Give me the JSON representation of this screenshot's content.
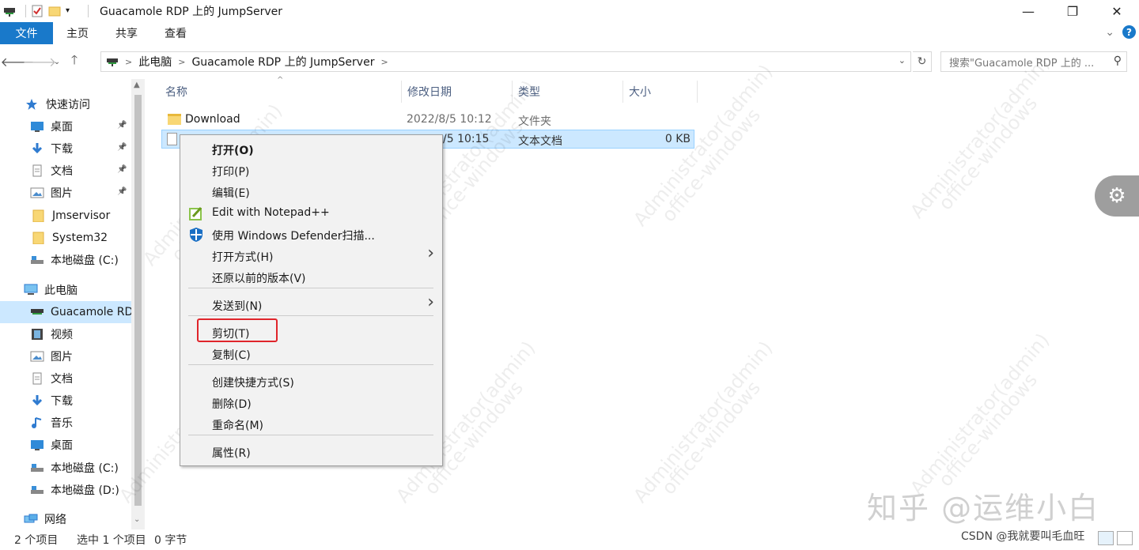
{
  "window": {
    "title": "Guacamole RDP 上的 JumpServer",
    "minimize": "—",
    "restore": "❐",
    "close": "✕"
  },
  "ribbon": {
    "tabs": [
      "文件",
      "主页",
      "共享",
      "查看"
    ],
    "expand": "⌄",
    "help": "?"
  },
  "address": {
    "crumbs": [
      "此电脑",
      "Guacamole RDP 上的 JumpServer"
    ],
    "search_placeholder": "搜索\"Guacamole RDP 上的 ..."
  },
  "sidebar": {
    "items": [
      {
        "label": "快速访问",
        "icon": "star-icon"
      },
      {
        "label": "桌面",
        "icon": "desktop-icon",
        "pinned": true
      },
      {
        "label": "下载",
        "icon": "download-icon",
        "pinned": true
      },
      {
        "label": "文档",
        "icon": "document-icon",
        "pinned": true
      },
      {
        "label": "图片",
        "icon": "picture-icon",
        "pinned": true
      },
      {
        "label": "Jmservisor",
        "icon": "folder-icon"
      },
      {
        "label": "System32",
        "icon": "folder-icon"
      },
      {
        "label": "本地磁盘 (C:)",
        "icon": "drive-icon"
      },
      {
        "label": "此电脑",
        "icon": "computer-icon"
      },
      {
        "label": "Guacamole RD",
        "icon": "network-drive-icon"
      },
      {
        "label": "视频",
        "icon": "video-icon"
      },
      {
        "label": "图片",
        "icon": "picture-icon"
      },
      {
        "label": "文档",
        "icon": "document-icon"
      },
      {
        "label": "下载",
        "icon": "download-icon"
      },
      {
        "label": "音乐",
        "icon": "music-icon"
      },
      {
        "label": "桌面",
        "icon": "desktop-icon"
      },
      {
        "label": "本地磁盘 (C:)",
        "icon": "drive-icon"
      },
      {
        "label": "本地磁盘 (D:)",
        "icon": "drive-icon"
      },
      {
        "label": "网络",
        "icon": "network-icon"
      }
    ]
  },
  "filelist": {
    "columns": [
      "名称",
      "修改日期",
      "类型",
      "大小"
    ],
    "rows": [
      {
        "name": "Download",
        "date": "2022/8/5 10:12",
        "type": "文件夹",
        "size": ""
      },
      {
        "name": "",
        "date": "/5 10:15",
        "type": "文本文档",
        "size": "0 KB"
      }
    ]
  },
  "context_menu": {
    "items": [
      {
        "label": "打开(O)",
        "bold": true
      },
      {
        "label": "打印(P)"
      },
      {
        "label": "编辑(E)"
      },
      {
        "label": "Edit with Notepad++",
        "icon": "notepadpp-icon"
      },
      {
        "label": "使用 Windows Defender扫描...",
        "icon": "defender-icon"
      },
      {
        "label": "打开方式(H)",
        "submenu": true
      },
      {
        "label": "还原以前的版本(V)"
      },
      {
        "label": "发送到(N)",
        "submenu": true
      },
      {
        "label": "剪切(T)",
        "highlighted": true
      },
      {
        "label": "复制(C)"
      },
      {
        "label": "创建快捷方式(S)"
      },
      {
        "label": "删除(D)"
      },
      {
        "label": "重命名(M)"
      },
      {
        "label": "属性(R)"
      }
    ]
  },
  "status": {
    "count": "2 个项目",
    "selection": "选中 1 个项目",
    "size": "0 字节"
  },
  "watermark": {
    "line1": "Administrator(admin)",
    "line2": "office-windows"
  },
  "brand": "知乎 @运维小白",
  "credit": "CSDN @我就要叫毛血旺",
  "colors": {
    "accent": "#1979ca",
    "selection": "#cce8ff",
    "highlight_box": "#e0252b"
  }
}
